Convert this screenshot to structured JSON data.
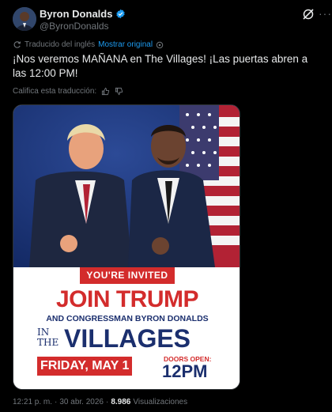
{
  "author": {
    "name": "Byron Donalds",
    "handle": "@ByronDonalds"
  },
  "translation": {
    "label": "Traducido del inglés",
    "show_original": "Mostrar original"
  },
  "tweet": {
    "text": "¡Nos veremos MAÑANA en The Villages! ¡Las puertas abren a las 12:00 PM!"
  },
  "rate_translation": "Califica esta traducción:",
  "flyer": {
    "invite": "YOU'RE INVITED",
    "headline": "JOIN TRUMP",
    "subline": "AND CONGRESSMAN BYRON DONALDS",
    "in_the_1": "IN",
    "in_the_2": "THE",
    "villages": "VILLAGES",
    "date": "FRIDAY, MAY 1",
    "doors_label": "DOORS OPEN:",
    "doors_time": "12PM"
  },
  "meta": {
    "time": "12:21 p. m.",
    "sep1": "·",
    "date": "30 abr. 2026",
    "sep2": "·",
    "views": "8.986",
    "views_label": "Visualizaciones"
  },
  "colors": {
    "background": "#000000",
    "link": "#1d9bf0",
    "muted": "#71767b",
    "flyer_red": "#d32c2c",
    "flyer_navy": "#1b2f6e"
  },
  "icons": [
    "verified-badge-icon",
    "grok-icon",
    "more-icon",
    "translate-icon",
    "info-icon",
    "thumbs-up-icon",
    "thumbs-down-icon"
  ]
}
